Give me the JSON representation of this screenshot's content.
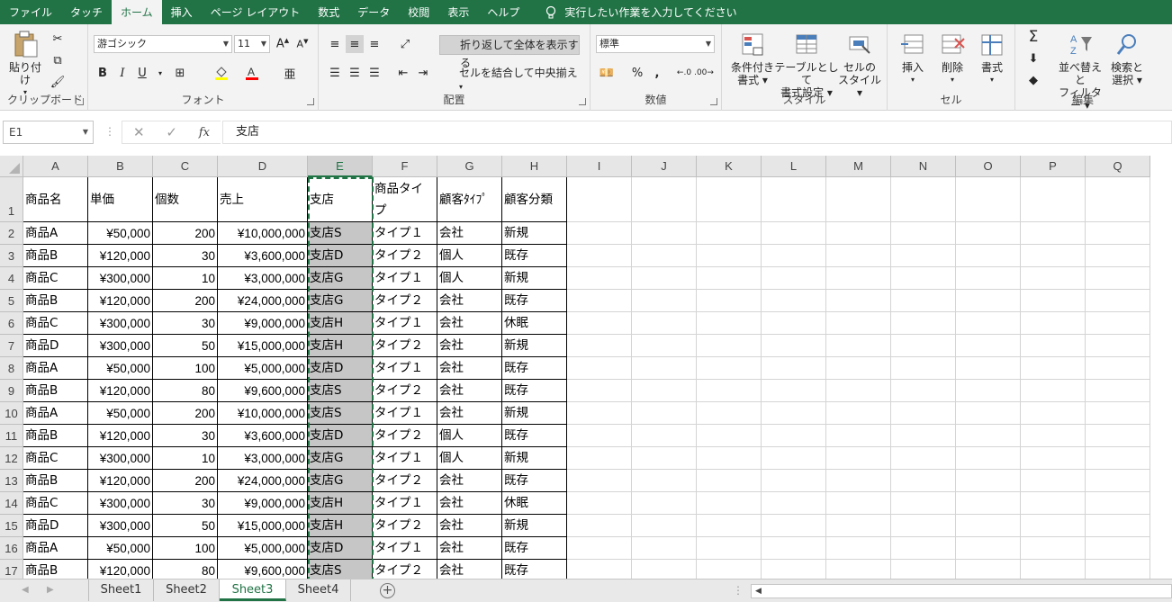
{
  "ribbon_tabs": [
    "ファイル",
    "タッチ",
    "ホーム",
    "挿入",
    "ページ レイアウト",
    "数式",
    "データ",
    "校閲",
    "表示",
    "ヘルプ"
  ],
  "active_tab_index": 2,
  "tell_me": "実行したい作業を入力してください",
  "groups": {
    "clipboard": {
      "label": "クリップボード",
      "paste": "貼り付け"
    },
    "font": {
      "label": "フォント",
      "font_name": "游ゴシック",
      "font_size": "11",
      "bold": "B",
      "italic": "I",
      "underline": "U"
    },
    "alignment": {
      "label": "配置",
      "wrap": "折り返して全体を表示する",
      "merge": "セルを結合して中央揃え"
    },
    "number": {
      "label": "数値",
      "format": "標準",
      "percent": "%",
      "comma": ","
    },
    "styles": {
      "label": "スタイル",
      "conditional": [
        "条件付き",
        "書式"
      ],
      "table": [
        "テーブルとして",
        "書式設定"
      ],
      "cell_style": [
        "セルの",
        "スタイル"
      ]
    },
    "cells": {
      "label": "セル",
      "insert": "挿入",
      "delete": "削除",
      "format": "書式"
    },
    "editing": {
      "label": "編集",
      "sort": [
        "並べ替えと",
        "フィルター"
      ],
      "find": [
        "検索と",
        "選択"
      ]
    }
  },
  "formula_bar": {
    "name_box": "E1",
    "content": "支店",
    "fx": "fx"
  },
  "columns": [
    "A",
    "B",
    "C",
    "D",
    "E",
    "F",
    "G",
    "H",
    "I",
    "J",
    "K",
    "L",
    "M",
    "N",
    "O",
    "P",
    "Q"
  ],
  "selected_column": "E",
  "header_row": [
    "商品名",
    "単価",
    "個数",
    "売上",
    "支店",
    "商品タイプ",
    "顧客ﾀｲﾌﾟ",
    "顧客分類"
  ],
  "rows": [
    [
      "商品A",
      "¥50,000",
      "200",
      "¥10,000,000",
      "支店S",
      "タイプ１",
      "会社",
      "新規"
    ],
    [
      "商品B",
      "¥120,000",
      "30",
      "¥3,600,000",
      "支店D",
      "タイプ２",
      "個人",
      "既存"
    ],
    [
      "商品C",
      "¥300,000",
      "10",
      "¥3,000,000",
      "支店G",
      "タイプ１",
      "個人",
      "新規"
    ],
    [
      "商品B",
      "¥120,000",
      "200",
      "¥24,000,000",
      "支店G",
      "タイプ２",
      "会社",
      "既存"
    ],
    [
      "商品C",
      "¥300,000",
      "30",
      "¥9,000,000",
      "支店H",
      "タイプ１",
      "会社",
      "休眠"
    ],
    [
      "商品D",
      "¥300,000",
      "50",
      "¥15,000,000",
      "支店H",
      "タイプ２",
      "会社",
      "新規"
    ],
    [
      "商品A",
      "¥50,000",
      "100",
      "¥5,000,000",
      "支店D",
      "タイプ１",
      "会社",
      "既存"
    ],
    [
      "商品B",
      "¥120,000",
      "80",
      "¥9,600,000",
      "支店S",
      "タイプ２",
      "会社",
      "既存"
    ],
    [
      "商品A",
      "¥50,000",
      "200",
      "¥10,000,000",
      "支店S",
      "タイプ１",
      "会社",
      "新規"
    ],
    [
      "商品B",
      "¥120,000",
      "30",
      "¥3,600,000",
      "支店D",
      "タイプ２",
      "個人",
      "既存"
    ],
    [
      "商品C",
      "¥300,000",
      "10",
      "¥3,000,000",
      "支店G",
      "タイプ１",
      "個人",
      "新規"
    ],
    [
      "商品B",
      "¥120,000",
      "200",
      "¥24,000,000",
      "支店G",
      "タイプ２",
      "会社",
      "既存"
    ],
    [
      "商品C",
      "¥300,000",
      "30",
      "¥9,000,000",
      "支店H",
      "タイプ１",
      "会社",
      "休眠"
    ],
    [
      "商品D",
      "¥300,000",
      "50",
      "¥15,000,000",
      "支店H",
      "タイプ２",
      "会社",
      "新規"
    ],
    [
      "商品A",
      "¥50,000",
      "100",
      "¥5,000,000",
      "支店D",
      "タイプ１",
      "会社",
      "既存"
    ],
    [
      "商品B",
      "¥120,000",
      "80",
      "¥9,600,000",
      "支店S",
      "タイプ２",
      "会社",
      "既存"
    ]
  ],
  "sheets": [
    "Sheet1",
    "Sheet2",
    "Sheet3",
    "Sheet4"
  ],
  "active_sheet_index": 2,
  "colors": {
    "accent": "#217346",
    "selected_fill": "#c6c6c6"
  }
}
